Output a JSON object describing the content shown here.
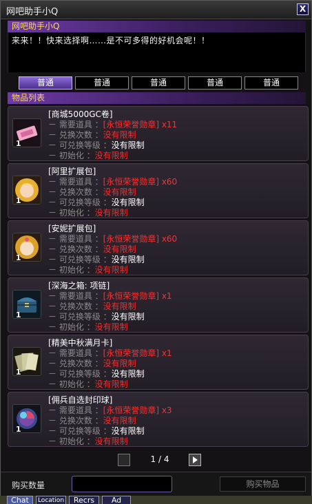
{
  "window": {
    "title": "网吧助手小Q",
    "close_glyph": "X"
  },
  "npc": {
    "name": "网吧助手小Q",
    "message": "来来！！快来选择啊……是不可多得的好机会呢！！"
  },
  "tabs": [
    {
      "label": "普通",
      "active": true
    },
    {
      "label": "普通",
      "active": false
    },
    {
      "label": "普通",
      "active": false
    },
    {
      "label": "普通",
      "active": false
    },
    {
      "label": "普通",
      "active": false
    }
  ],
  "list_header": "物品列表",
  "labels": {
    "required_item": "－ 需要道具 ：",
    "exchange_count": "－ 兑换次数 ：",
    "exchange_level": "－ 可兑换等级 ：",
    "reset": "－ 初始化 ："
  },
  "items": [
    {
      "name": "[商城5000GC卷]",
      "icon": "gc-ticket-icon",
      "quantity": "1",
      "required_item": "[永恒荣誉勋章] x11",
      "exchange_count": "没有限制",
      "exchange_level": "没有限制",
      "reset": "没有限制"
    },
    {
      "name": "[阿里扩展包]",
      "icon": "ali-portrait-icon",
      "quantity": "1",
      "required_item": "[永恒荣誉勋章] x60",
      "exchange_count": "没有限制",
      "exchange_level": "没有限制",
      "reset": "没有限制"
    },
    {
      "name": "[安妮扩展包]",
      "icon": "annie-portrait-icon",
      "quantity": "1",
      "required_item": "[永恒荣誉勋章] x60",
      "exchange_count": "没有限制",
      "exchange_level": "没有限制",
      "reset": "没有限制"
    },
    {
      "name": "[深海之箱: 项链]",
      "icon": "deep-sea-chest-icon",
      "quantity": "1",
      "required_item": "[永恒荣誉勋章] x1",
      "exchange_count": "没有限制",
      "exchange_level": "没有限制",
      "reset": "没有限制"
    },
    {
      "name": "[精美中秋满月卡]",
      "icon": "card-pack-icon",
      "quantity": "1",
      "required_item": "[永恒荣誉勋章] x1",
      "exchange_count": "没有限制",
      "exchange_level": "没有限制",
      "reset": "没有限制"
    },
    {
      "name": "[佣兵自选封印球]",
      "icon": "seal-orb-icon",
      "quantity": "1",
      "required_item": "[永恒荣誉勋章] x3",
      "exchange_count": "没有限制",
      "exchange_level": "没有限制",
      "reset": "没有限制"
    }
  ],
  "pagination": {
    "current": "1",
    "separator": "/",
    "total": "4"
  },
  "bottom": {
    "quantity_label": "购买数量",
    "quantity_value": "",
    "buy_button": "购买物品"
  },
  "chat_tabs": [
    "Chat",
    "Location",
    "Recrs",
    "Ad"
  ],
  "colors": {
    "accent_purple": "#6d3aa6",
    "header_text": "#ffd75a",
    "required_red": "#ff3030",
    "label_gray": "#8c8c8c"
  }
}
